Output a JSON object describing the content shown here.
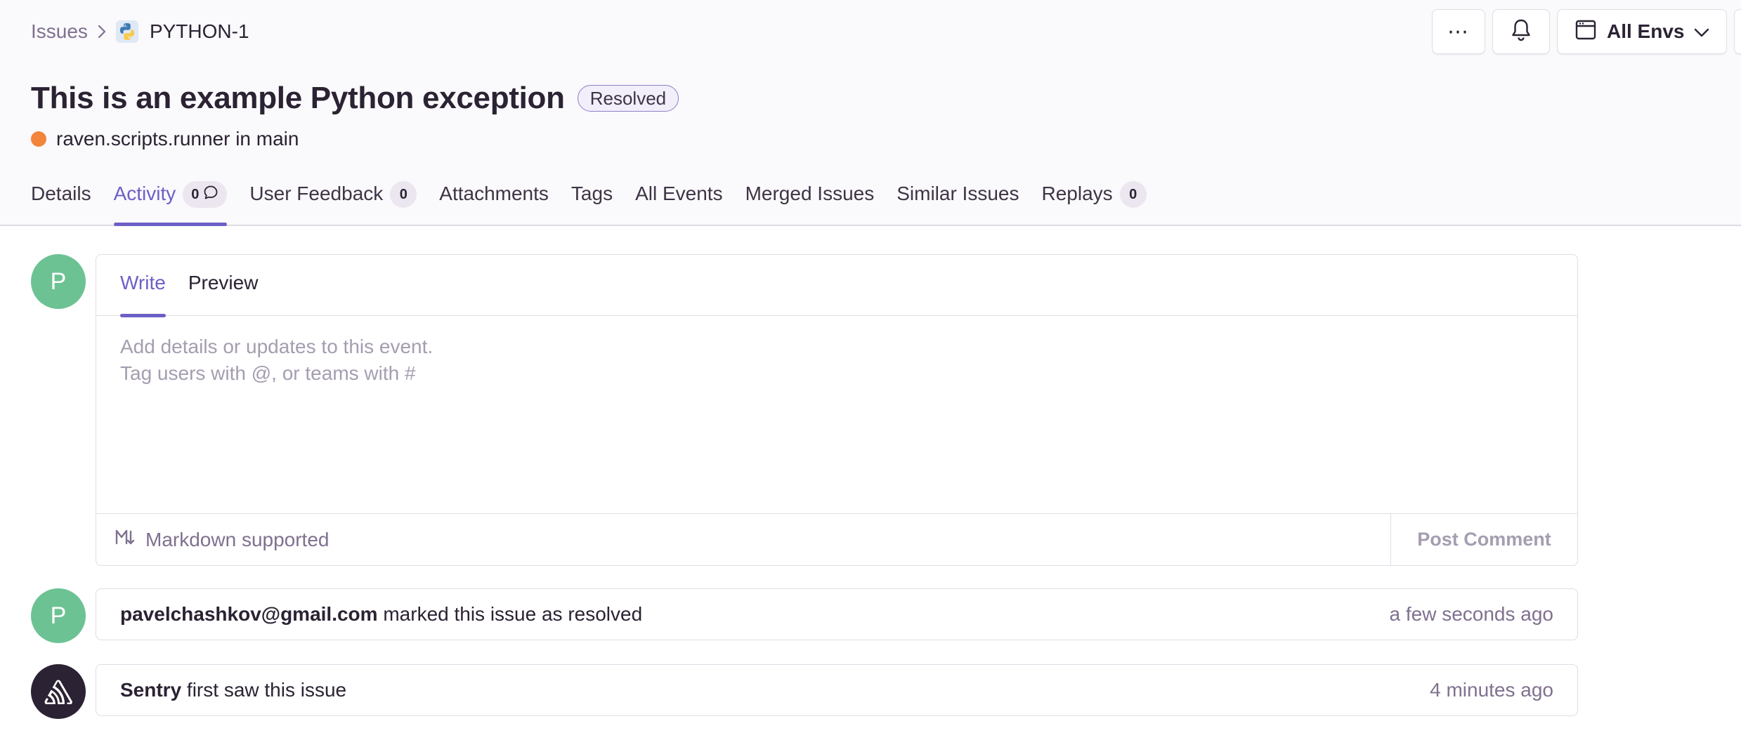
{
  "breadcrumb": {
    "parent": "Issues",
    "current": "PYTHON-1",
    "project_icon": "python-logo-icon"
  },
  "header_actions": {
    "more_label": "⋯",
    "bell_icon": "bell-icon",
    "env_label": "All Envs",
    "env_icon": "calendar-window-icon"
  },
  "issue": {
    "title": "This is an example Python exception",
    "status": "Resolved",
    "culprit": "raven.scripts.runner in main",
    "level_color": "#f2843b"
  },
  "tabs": [
    {
      "label": "Details"
    },
    {
      "label": "Activity",
      "count": "0",
      "icon": "comment-icon",
      "active": true
    },
    {
      "label": "User Feedback",
      "count": "0"
    },
    {
      "label": "Attachments"
    },
    {
      "label": "Tags"
    },
    {
      "label": "All Events"
    },
    {
      "label": "Merged Issues"
    },
    {
      "label": "Similar Issues"
    },
    {
      "label": "Replays",
      "count": "0"
    }
  ],
  "composer": {
    "avatar_letter": "P",
    "tabs": [
      "Write",
      "Preview"
    ],
    "active_tab": "Write",
    "placeholder": "Add details or updates to this event.\nTag users with @, or teams with #",
    "value": "",
    "markdown_hint": "Markdown supported",
    "post_label": "Post Comment"
  },
  "activity": [
    {
      "avatar_letter": "P",
      "actor": "pavelchashkov@gmail.com",
      "text": " marked this issue as resolved",
      "time": "a few seconds ago"
    },
    {
      "avatar_icon": "sentry-logo-icon",
      "actor": "Sentry",
      "text": " first saw this issue",
      "time": "4 minutes ago"
    }
  ],
  "colors": {
    "accent": "#6c5fc7",
    "avatar_green": "#6cc293",
    "sentry_dark": "#2b2233",
    "muted_text": "#80708f"
  }
}
